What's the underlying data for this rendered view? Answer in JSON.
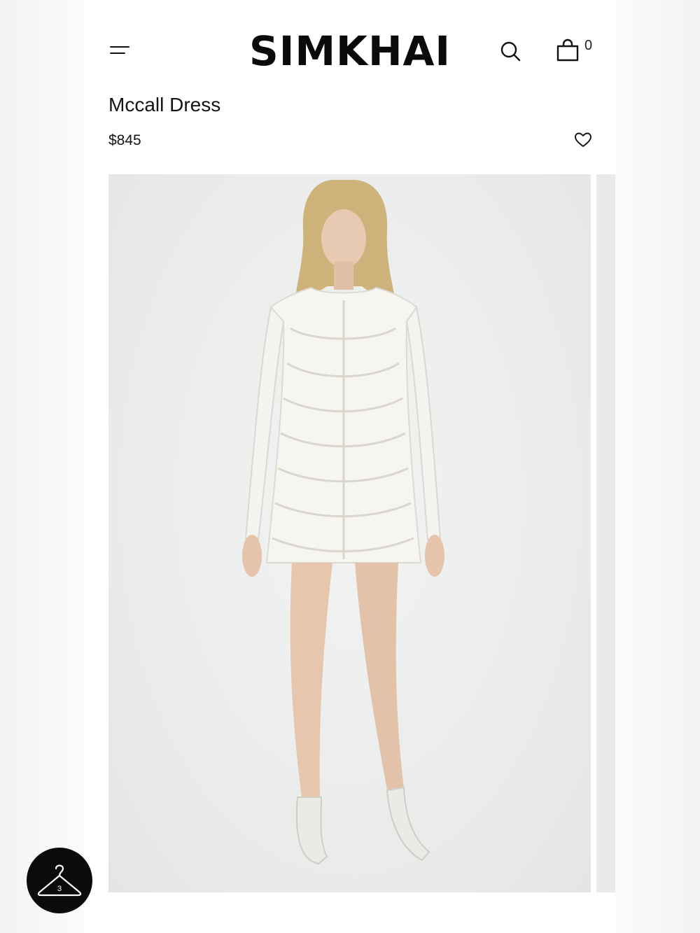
{
  "brand": {
    "name": "SIMKHAI"
  },
  "header": {
    "menu_icon": "menu-icon",
    "search_icon": "search-icon",
    "cart_icon": "shopping-bag-icon",
    "cart_count": "0"
  },
  "product": {
    "title": "Mccall Dress",
    "price": "$845",
    "wishlist_icon": "heart-icon"
  },
  "gallery": {
    "main_image": "model-in-white-lace-dress",
    "next_image": "next-slide-peek"
  },
  "floating": {
    "hanger_icon": "hanger-icon",
    "hanger_count": "3"
  },
  "colors": {
    "text": "#111111",
    "floating_button": "#0b0b0b",
    "background": "#ffffff"
  }
}
